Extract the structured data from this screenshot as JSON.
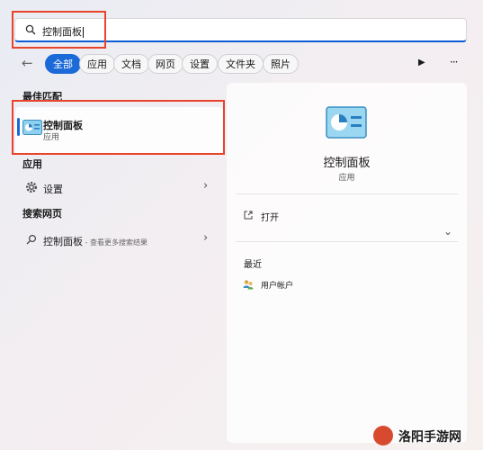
{
  "search": {
    "query": "控制面板"
  },
  "filters": {
    "back": "←",
    "tabs": [
      "全部",
      "应用",
      "文档",
      "网页",
      "设置",
      "文件夹",
      "照片"
    ],
    "play": "▶",
    "more": "···"
  },
  "results": {
    "best_match_header": "最佳匹配",
    "best_match": {
      "title": "控制面板",
      "subtitle": "应用"
    },
    "apps_header": "应用",
    "apps": [
      {
        "label": "设置",
        "chevron": "›"
      }
    ],
    "web_header": "搜索网页",
    "web": {
      "query": "控制面板",
      "suffix": " - 查看更多搜索结果",
      "chevron": "›"
    }
  },
  "detail": {
    "title": "控制面板",
    "subtitle": "应用",
    "open_label": "打开",
    "expand": "⌄",
    "recent_header": "最近",
    "recent_items": [
      {
        "label": "用户帐户"
      }
    ]
  },
  "watermark": {
    "text": "洛阳手游网"
  },
  "colors": {
    "accent": "#1b6ad8",
    "highlight": "#e8442c"
  }
}
